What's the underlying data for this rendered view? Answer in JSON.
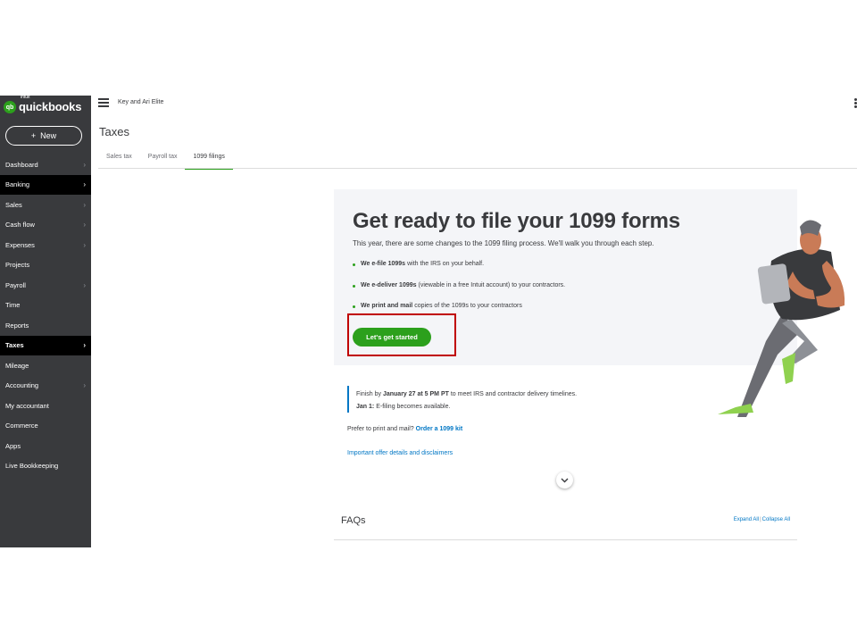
{
  "brand": {
    "intuit": "intuit",
    "name": "quickbooks",
    "badge": "qb",
    "color": "#2ca01c"
  },
  "new_button": {
    "icon": "+",
    "label": "New"
  },
  "sidebar": {
    "items": [
      {
        "label": "Dashboard",
        "chevron": true
      },
      {
        "label": "Banking",
        "chevron": true
      },
      {
        "label": "Sales",
        "chevron": true
      },
      {
        "label": "Cash flow",
        "chevron": true
      },
      {
        "label": "Expenses",
        "chevron": true
      },
      {
        "label": "Projects",
        "chevron": false
      },
      {
        "label": "Payroll",
        "chevron": true
      },
      {
        "label": "Time",
        "chevron": false
      },
      {
        "label": "Reports",
        "chevron": false
      },
      {
        "label": "Taxes",
        "chevron": true,
        "active": true
      },
      {
        "label": "Mileage",
        "chevron": false
      },
      {
        "label": "Accounting",
        "chevron": true
      },
      {
        "label": "My accountant",
        "chevron": false
      },
      {
        "label": "Commerce",
        "chevron": false
      },
      {
        "label": "Apps",
        "chevron": false
      },
      {
        "label": "Live Bookkeeping",
        "chevron": false
      }
    ]
  },
  "header": {
    "company": "Key and Ari Elite"
  },
  "page": {
    "title": "Taxes",
    "tabs": [
      "Sales tax",
      "Payroll tax",
      "1099 filings"
    ],
    "active_tab": "1099 filings"
  },
  "hero": {
    "title": "Get ready to file your 1099 forms",
    "intro": "This year, there are some changes to the 1099 filing process. We'll walk you through each step.",
    "bullets": [
      {
        "bold": "We e-file 1099s",
        "rest": "with the IRS on your behalf."
      },
      {
        "bold": "We e-deliver 1099s",
        "rest": "(viewable in a free Intuit account) to your contractors."
      },
      {
        "bold": "We print and mail",
        "rest": "copies of the 1099s to your contractors"
      }
    ],
    "cta": "Let's get started"
  },
  "info": {
    "line1_pre": "Finish by",
    "line1_bold": "January 27 at 5 PM PT",
    "line1_post": "to meet IRS and contractor delivery timelines.",
    "line2_bold": "Jan 1:",
    "line2_post": "E-filing becomes available."
  },
  "prefer": {
    "text": "Prefer to print and mail?",
    "link": "Order a 1099 kit"
  },
  "disclaimer": "Important offer details and disclaimers",
  "faq": {
    "title": "FAQs",
    "expand": "Expand All",
    "sep": "|",
    "collapse": "Collapse All"
  }
}
